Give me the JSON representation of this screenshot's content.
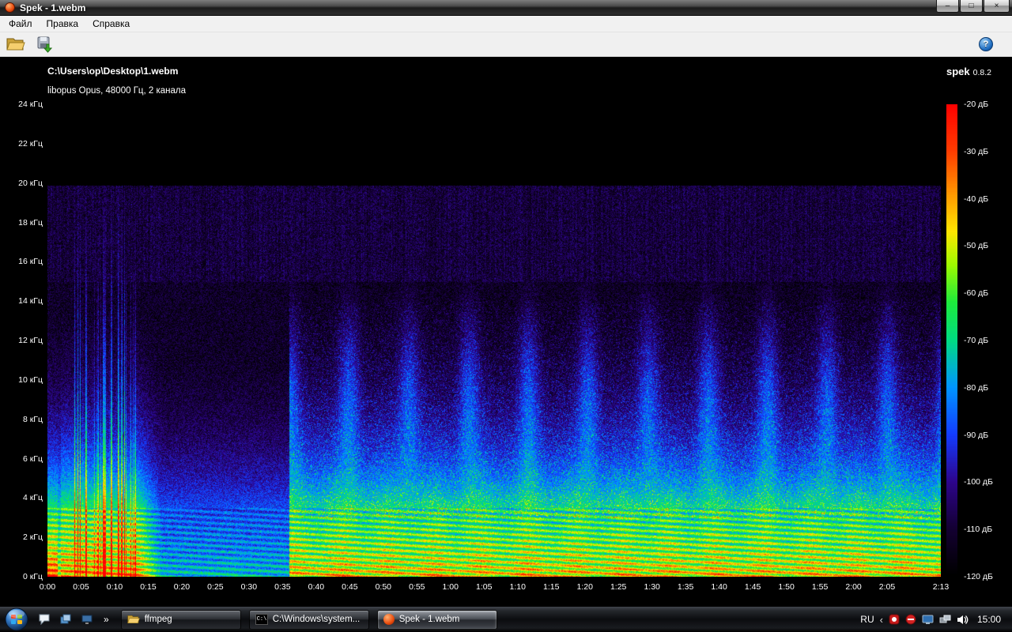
{
  "window": {
    "title": "Spek - 1.webm",
    "menu": [
      {
        "label": "Файл"
      },
      {
        "label": "Правка"
      },
      {
        "label": "Справка"
      }
    ],
    "controls": {
      "minimize": "–",
      "maximize": "□",
      "close": "×"
    },
    "help": "?"
  },
  "spek": {
    "file_path": "C:\\Users\\op\\Desktop\\1.webm",
    "stream_info": "libopus Opus, 48000 Гц, 2 канала",
    "app_name": "spek",
    "app_version": "0.8.2",
    "duration_sec": 133,
    "max_freq_khz": 24,
    "cutoff_khz": 20,
    "freq_labels": [
      "24 кГц",
      "22 кГц",
      "20 кГц",
      "18 кГц",
      "16 кГц",
      "14 кГц",
      "12 кГц",
      "10 кГц",
      "8 кГц",
      "6 кГц",
      "4 кГц",
      "2 кГц",
      "0 кГц"
    ],
    "time_labels": [
      "0:00",
      "0:05",
      "0:10",
      "0:15",
      "0:20",
      "0:25",
      "0:30",
      "0:35",
      "0:40",
      "0:45",
      "0:50",
      "0:55",
      "1:00",
      "1:05",
      "1:10",
      "1:15",
      "1:20",
      "1:25",
      "1:30",
      "1:35",
      "1:40",
      "1:45",
      "1:50",
      "1:55",
      "2:00",
      "2:05",
      "2:13"
    ],
    "db_labels": [
      "-20 дБ",
      "-30 дБ",
      "-40 дБ",
      "-50 дБ",
      "-60 дБ",
      "-70 дБ",
      "-80 дБ",
      "-90 дБ",
      "-100 дБ",
      "-110 дБ",
      "-120 дБ"
    ],
    "palette": [
      "#000000",
      "#140032",
      "#2d058c",
      "#143cff",
      "#0096ff",
      "#00dc82",
      "#1eeb3c",
      "#a0fa00",
      "#ffe600",
      "#ff9600",
      "#ff3c00",
      "#ff0000"
    ]
  },
  "taskbar": {
    "overflow_glyph": "»",
    "buttons": [
      {
        "label": "ffmpeg"
      },
      {
        "label": "C:\\Windows\\system..."
      },
      {
        "label": "Spek - 1.webm"
      }
    ],
    "tray": {
      "chevron": "‹",
      "lang": "RU",
      "clock": "15:00"
    }
  },
  "icons": {
    "cmd_glyph": "C:\\"
  }
}
